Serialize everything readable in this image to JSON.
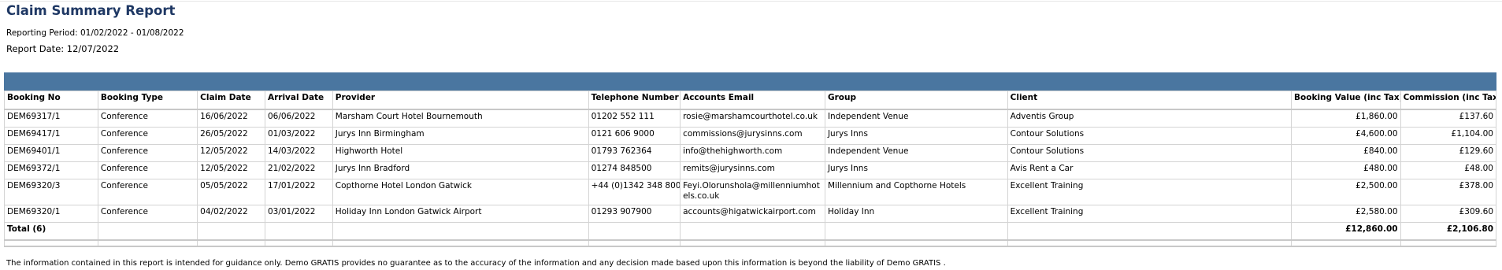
{
  "report": {
    "title": "Claim Summary Report",
    "reporting_period": "Reporting Period: 01/02/2022 - 01/08/2022",
    "report_date": "Report Date: 12/07/2022"
  },
  "table": {
    "headers": [
      "Booking No",
      "Booking Type",
      "Claim Date",
      "Arrival Date",
      "Provider",
      "Telephone Number",
      "Accounts Email",
      "Group",
      "Client",
      "Booking Value (inc Tax)",
      "Commission (inc Tax)"
    ],
    "rows": [
      [
        "DEM69317/1",
        "Conference",
        "16/06/2022",
        "06/06/2022",
        "Marsham Court Hotel Bournemouth",
        "01202 552 111",
        "rosie@marshamcourthotel.co.uk",
        "Independent Venue",
        "Adventis Group",
        "£1,860.00",
        "£137.60"
      ],
      [
        "DEM69417/1",
        "Conference",
        "26/05/2022",
        "01/03/2022",
        "Jurys Inn Birmingham",
        "0121 606 9000",
        "commissions@jurysinns.com",
        "Jurys Inns",
        "Contour Solutions",
        "£4,600.00",
        "£1,104.00"
      ],
      [
        "DEM69401/1",
        "Conference",
        "12/05/2022",
        "14/03/2022",
        "Highworth Hotel",
        "01793 762364",
        "info@thehighworth.com",
        "Independent Venue",
        "Contour Solutions",
        "£840.00",
        "£129.60"
      ],
      [
        "DEM69372/1",
        "Conference",
        "12/05/2022",
        "21/02/2022",
        "Jurys Inn Bradford",
        "01274 848500",
        "remits@jurysinns.com",
        "Jurys Inns",
        "Avis Rent a Car",
        "£480.00",
        "£48.00"
      ],
      [
        "DEM69320/3",
        "Conference",
        "05/05/2022",
        "17/01/2022",
        "Copthorne Hotel London Gatwick",
        "+44 (0)1342 348 800",
        "Feyi.Olorunshola@millenniumhotels.co.uk",
        "Millennium and Copthorne Hotels",
        "Excellent Training",
        "£2,500.00",
        "£378.00"
      ],
      [
        "DEM69320/1",
        "Conference",
        "04/02/2022",
        "03/01/2022",
        "Holiday Inn London Gatwick Airport",
        "01293 907900",
        "accounts@higatwickairport.com",
        "Holiday Inn",
        "Excellent Training",
        "£2,580.00",
        "£309.60"
      ]
    ],
    "total": {
      "label": "Total (6)",
      "booking_value": "£12,860.00",
      "commission": "£2,106.80"
    }
  },
  "colors": {
    "title": "#1f3864",
    "header_bar": "#4a76a0",
    "grid_line": "#d4d4d4"
  },
  "disclaimer": "The information contained in this report is intended for guidance only.  Demo GRATIS provides no guarantee as to the accuracy of the information and any decision made based upon this information is beyond the liability of Demo GRATIS ."
}
